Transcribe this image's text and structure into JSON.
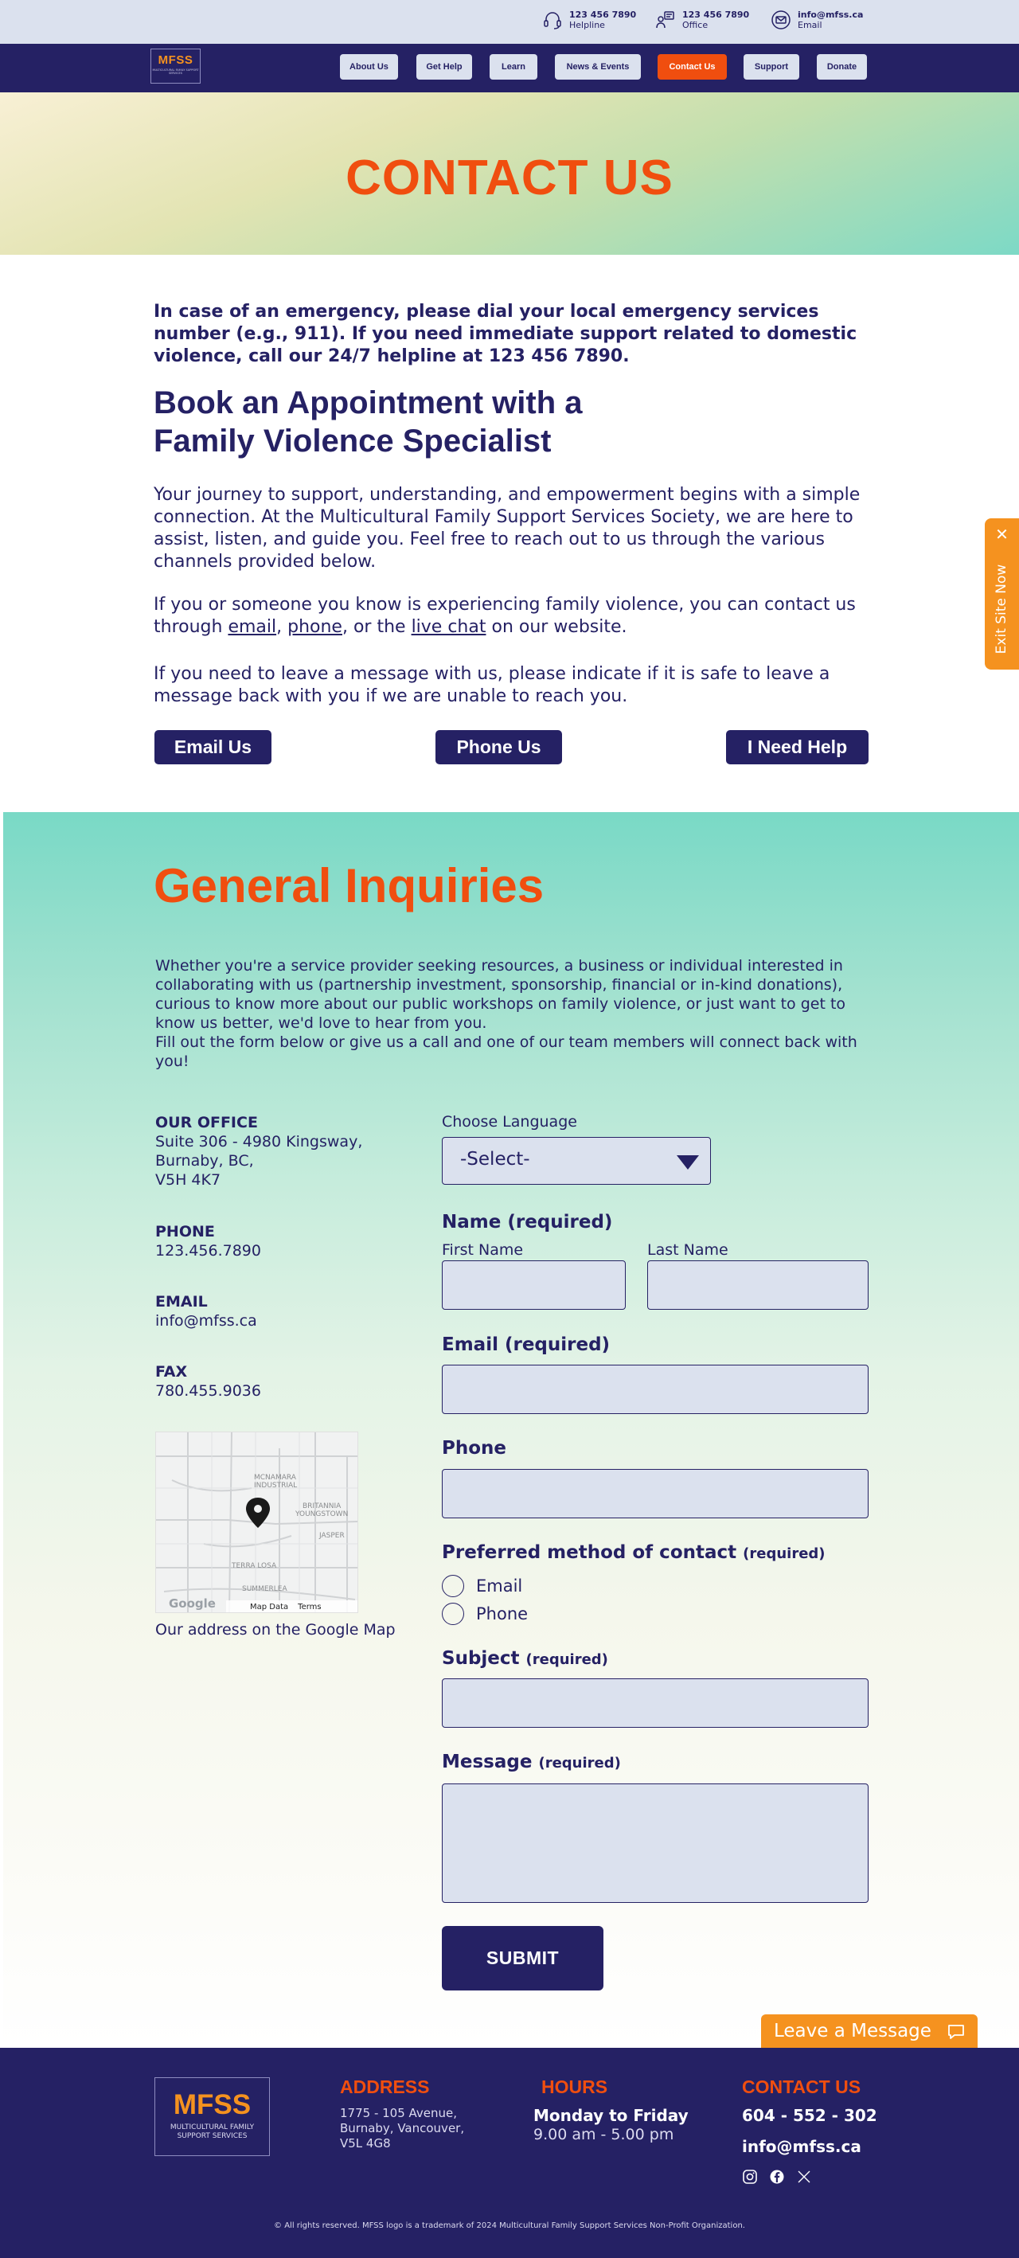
{
  "topbar": {
    "helpline": {
      "number": "123 456 7890",
      "label": "Helpline"
    },
    "office": {
      "number": "123 456 7890",
      "label": "Office"
    },
    "email": {
      "address": "info@mfss.ca",
      "label": "Email"
    }
  },
  "brand": {
    "logo": "MFSS",
    "tagline": "MULTICULTURAL FAMILY SUPPORT SERVICES"
  },
  "nav": {
    "items": [
      "About Us",
      "Get Help",
      "Learn",
      "News & Events",
      "Contact Us",
      "Support",
      "Donate"
    ],
    "active": "Contact Us"
  },
  "hero": {
    "title": "CONTACT US"
  },
  "intro": {
    "emergency": "In case of an emergency, please dial your local emergency services number (e.g., 911). If you need immediate support related to domestic violence, call our 24/7 helpline at 123 456 7890.",
    "heading": "Book an Appointment with a Family Violence Specialist",
    "p1": "Your journey to support, understanding, and empowerment begins with a simple connection. At the Multicultural Family Support Services Society, we are here to assist, listen, and guide you. Feel free to reach out to us through the various channels provided below.",
    "p2_a": "If you or someone you know is experiencing family violence, you can contact us through ",
    "p2_link1": "email",
    "p2_b": ", ",
    "p2_link2": "phone",
    "p2_c": ", or the ",
    "p2_link3": "live chat",
    "p2_d": " on our website.",
    "p3": "If you need to leave a message with us, please indicate if it is safe to leave a message back with you if we are unable to reach you."
  },
  "contact_buttons": [
    "Email Us",
    "Phone Us",
    "I Need Help"
  ],
  "exit": {
    "label": "Exit Site Now",
    "close": "✕"
  },
  "inquiries": {
    "title": "General Inquiries",
    "text": "Whether you're a service provider seeking resources, a business or individual interested in collaborating with us (partnership investment, sponsorship, financial or in-kind donations), curious to know more about our public workshops on family violence, or just want to get to know us better, we'd love to hear from you.",
    "text2": "Fill out the form below or give us a call and one of our team members will connect back with you!"
  },
  "office": {
    "office_h": "OUR OFFICE",
    "address": [
      "Suite 306 - 4980 Kingsway,",
      "Burnaby, BC,",
      "V5H 4K7"
    ],
    "phone_h": "PHONE",
    "phone": "123.456.7890",
    "email_h": "EMAIL",
    "email": "info@mfss.ca",
    "fax_h": "FAX",
    "fax": "780.455.9036",
    "map_caption": "Our address on the Google Map",
    "map_labels": [
      "MCNAMARA",
      "INDUSTRIAL",
      "BRITANNIA",
      "YOUNGSTOWN",
      "JASPER",
      "TERRA LOSA",
      "SUMMERLEA",
      "Google",
      "Map Data",
      "Terms"
    ]
  },
  "form": {
    "lang_label": "Choose Language",
    "lang_value": "-Select-",
    "name_h": "Name (required)",
    "first": "First Name",
    "last": "Last Name",
    "email_h": "Email (required)",
    "phone_h": "Phone",
    "pref_h": "Preferred method of contact",
    "pref_req": "(required)",
    "pref_opts": [
      "Email",
      "Phone"
    ],
    "subject_h": "Subject",
    "subject_req": "(required)",
    "message_h": "Message",
    "message_req": "(required)",
    "submit": "SUBMIT"
  },
  "leave": {
    "label": "Leave a Message"
  },
  "footer": {
    "address_h": "ADDRESS",
    "address": [
      "1775 - 105 Avenue,",
      "Burnaby, Vancouver,",
      "V5L 4G8"
    ],
    "hours_h": "HOURS",
    "hours_days": "Monday to Friday",
    "hours_time": "9.00 am - 5.00 pm",
    "contact_h": "CONTACT US",
    "phone": "604 - 552 - 302",
    "email": "info@mfss.ca",
    "copyright": "© All rights reserved. MFSS logo is a trademark of 2024 Multicultural Family Support Services Non-Profit Organization."
  },
  "colors": {
    "navy": "#252164",
    "orange": "#f04e0f",
    "amber": "#f5921f",
    "input": "#dbe1ee",
    "teal": "#79d9c6"
  }
}
